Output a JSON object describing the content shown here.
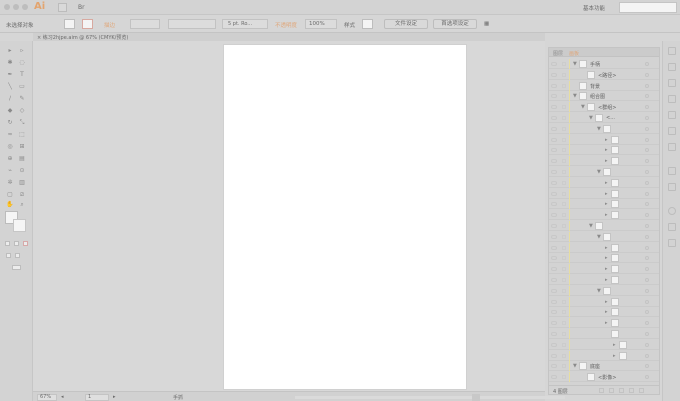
{
  "app": {
    "logo": "Ai",
    "bridge_label": "Br",
    "workspace_label": "基本功能"
  },
  "control_bar": {
    "selection_label": "未选择对象",
    "stroke_label": "描边",
    "stroke_weight": "5 pt. Ro...",
    "opacity_label": "不透明度",
    "opacity_value": "100%",
    "style_label": "样式",
    "doc_setup_button": "文件设定",
    "preferences_button": "首选项设定"
  },
  "document_tab": {
    "title": "练习2hjpe.aim @ 67% (CMYK/预览)",
    "close": "×"
  },
  "status_bar": {
    "zoom": "67%",
    "page": "1",
    "tool_label": "手抓"
  },
  "layers_panel": {
    "tabs": [
      "图层",
      "画板"
    ],
    "rows": [
      {
        "indent": 0,
        "expand": "▼",
        "name": "手柄"
      },
      {
        "indent": 1,
        "expand": "",
        "name": "<路径>"
      },
      {
        "indent": 0,
        "expand": "",
        "name": "背景"
      },
      {
        "indent": 0,
        "expand": "▼",
        "name": "组合图"
      },
      {
        "indent": 1,
        "expand": "▼",
        "name": "<群组>"
      },
      {
        "indent": 2,
        "expand": "▼",
        "name": "<..."
      },
      {
        "indent": 3,
        "expand": "▼",
        "name": ""
      },
      {
        "indent": 4,
        "expand": "▸",
        "name": ""
      },
      {
        "indent": 4,
        "expand": "▸",
        "name": ""
      },
      {
        "indent": 4,
        "expand": "▸",
        "name": ""
      },
      {
        "indent": 3,
        "expand": "▼",
        "name": ""
      },
      {
        "indent": 4,
        "expand": "▸",
        "name": ""
      },
      {
        "indent": 4,
        "expand": "▸",
        "name": ""
      },
      {
        "indent": 4,
        "expand": "▸",
        "name": ""
      },
      {
        "indent": 4,
        "expand": "▸",
        "name": ""
      },
      {
        "indent": 2,
        "expand": "▼",
        "name": ""
      },
      {
        "indent": 3,
        "expand": "▼",
        "name": ""
      },
      {
        "indent": 4,
        "expand": "▸",
        "name": ""
      },
      {
        "indent": 4,
        "expand": "▸",
        "name": ""
      },
      {
        "indent": 4,
        "expand": "▸",
        "name": ""
      },
      {
        "indent": 4,
        "expand": "▸",
        "name": ""
      },
      {
        "indent": 3,
        "expand": "▼",
        "name": ""
      },
      {
        "indent": 4,
        "expand": "▸",
        "name": ""
      },
      {
        "indent": 4,
        "expand": "▸",
        "name": ""
      },
      {
        "indent": 4,
        "expand": "▸",
        "name": ""
      },
      {
        "indent": 4,
        "expand": "",
        "name": ""
      },
      {
        "indent": 5,
        "expand": "▸",
        "name": ""
      },
      {
        "indent": 5,
        "expand": "▸",
        "name": ""
      },
      {
        "indent": 0,
        "expand": "▼",
        "name": "底座"
      },
      {
        "indent": 1,
        "expand": "",
        "name": "<影像>"
      }
    ],
    "footer_label": "4 图层"
  },
  "colors": {
    "app_bg": "#d6d6d6",
    "artboard": "#ffffff",
    "accent_orange": "#e0a77a",
    "layer_color": "#e8dea0"
  }
}
